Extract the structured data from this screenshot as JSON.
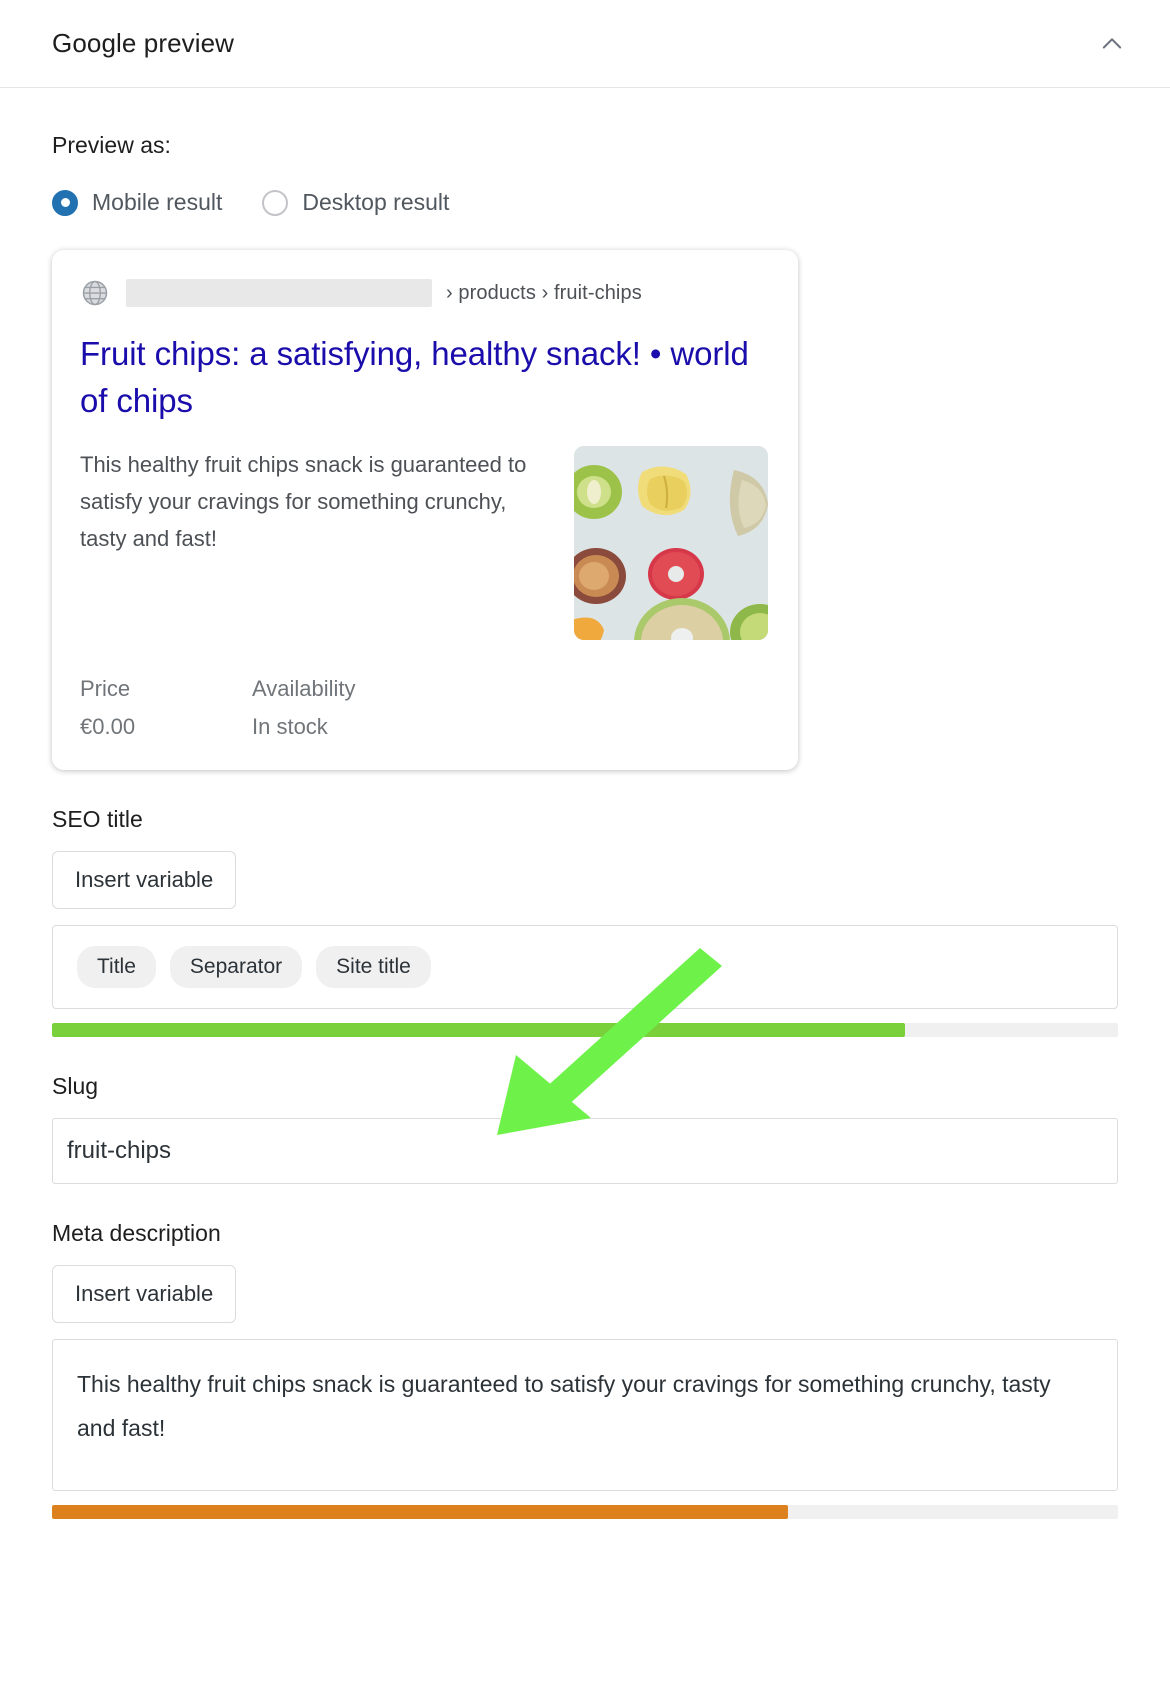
{
  "header": {
    "title": "Google preview",
    "collapse_icon": "chevron-up-icon"
  },
  "preview_as": {
    "label": "Preview as:",
    "options": [
      {
        "label": "Mobile result",
        "selected": true
      },
      {
        "label": "Desktop result",
        "selected": false
      }
    ]
  },
  "serp_preview": {
    "favicon_icon": "globe-icon",
    "url_redacted": true,
    "url_breadcrumbs": "› products › fruit-chips",
    "title": "Fruit chips: a satisfying, healthy snack! • world of chips",
    "description": "This healthy fruit chips snack is guaranteed to satisfy your cravings for something crunchy, tasty and fast!",
    "thumbnail_alt": "dried fruit chips photo",
    "meta": [
      {
        "head": "Price",
        "value": "€0.00"
      },
      {
        "head": "Availability",
        "value": "In stock"
      }
    ]
  },
  "seo_title": {
    "label": "SEO title",
    "insert_variable_label": "Insert variable",
    "variables": [
      "Title",
      "Separator",
      "Site title"
    ],
    "progress_percent": 80,
    "progress_color": "#7ad03a"
  },
  "slug": {
    "label": "Slug",
    "value": "fruit-chips"
  },
  "meta_description": {
    "label": "Meta description",
    "insert_variable_label": "Insert variable",
    "value": "This healthy fruit chips snack is guaranteed to satisfy your cravings for something crunchy, tasty and fast!",
    "progress_percent": 69,
    "progress_color": "#dd811e"
  },
  "annotation": {
    "type": "arrow",
    "color": "#6ef24a",
    "points_to": "slug-input"
  },
  "colors": {
    "accent_blue": "#2271b1",
    "serp_link": "#1a0dab",
    "text_primary": "#1e1e1e",
    "text_muted": "#70757a"
  }
}
